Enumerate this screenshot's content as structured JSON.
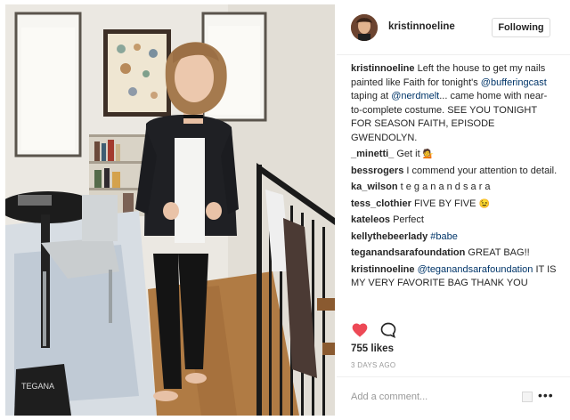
{
  "post": {
    "author": "kristinnoeline",
    "follow_label": "Following",
    "comments": [
      {
        "user": "kristinnoeline",
        "parts": [
          {
            "t": "Left the house to get my nails painted like Faith for tonight's "
          },
          {
            "t": "@bufferingcast",
            "mention": true
          },
          {
            "t": " taping at "
          },
          {
            "t": "@nerdmelt",
            "mention": true
          },
          {
            "t": "... came home with near-to-complete costume. SEE YOU TONIGHT FOR SEASON FAITH, EPISODE GWENDOLYN."
          }
        ]
      },
      {
        "user": "_minetti_",
        "parts": [
          {
            "t": "Get it "
          },
          {
            "t": "💁",
            "emoji": true
          }
        ]
      },
      {
        "user": "bessrogers",
        "parts": [
          {
            "t": "I commend your attention to detail."
          }
        ]
      },
      {
        "user": "ka_wilson",
        "parts": [
          {
            "t": "t e g a n a n d s a r a"
          }
        ]
      },
      {
        "user": "tess_clothier",
        "parts": [
          {
            "t": "FIVE BY FIVE "
          },
          {
            "t": "😉",
            "emoji": true
          }
        ]
      },
      {
        "user": "kateleos",
        "parts": [
          {
            "t": "Perfect"
          }
        ]
      },
      {
        "user": "kellythebeerlady",
        "parts": [
          {
            "t": "#babe",
            "mention": true
          }
        ]
      },
      {
        "user": "teganandsarafoundation",
        "parts": [
          {
            "t": "GREAT BAG!!"
          }
        ]
      },
      {
        "user": "kristinnoeline",
        "parts": [
          {
            "t": "@teganandsarafoundation",
            "mention": true
          },
          {
            "t": " IT IS MY VERY FAVORITE BAG THANK YOU"
          }
        ]
      }
    ],
    "likes": "755 likes",
    "timestamp": "3 DAYS AGO",
    "comment_placeholder": "Add a comment...",
    "more_label": "•••",
    "bag_text": "TEGANA"
  },
  "colors": {
    "heart": "#ed4956",
    "mention": "#003569",
    "username": "#262626",
    "muted": "#999999"
  },
  "icons": {
    "heart": "heart-icon",
    "comment": "comment-icon",
    "more": "more-options-icon",
    "upload": "upload-icon"
  }
}
